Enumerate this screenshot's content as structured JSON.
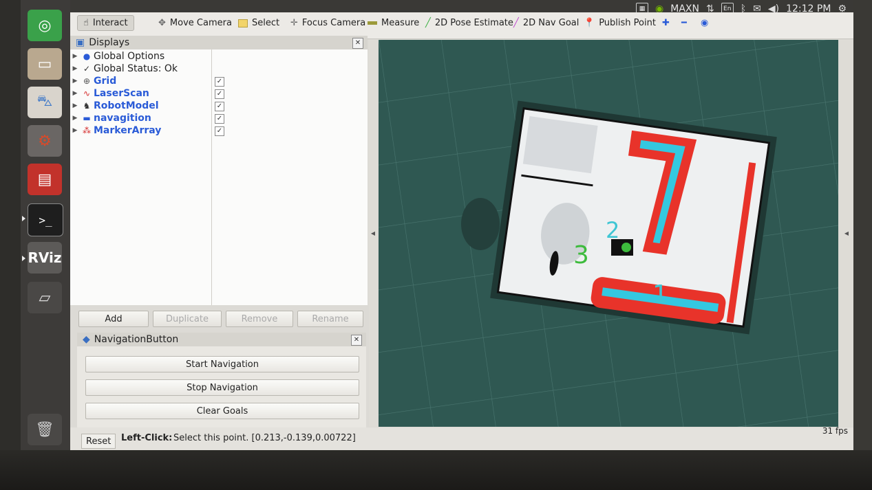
{
  "topbar": {
    "indicators": [
      "MAXN",
      "En"
    ],
    "time": "12:12 PM"
  },
  "launcher": {
    "rviz_label": "RViz"
  },
  "toolbar": {
    "tools": [
      {
        "label": "Interact",
        "icon": "hand-icon"
      },
      {
        "label": "Move Camera",
        "icon": "move-camera-icon"
      },
      {
        "label": "Select",
        "icon": "select-icon"
      },
      {
        "label": "Focus Camera",
        "icon": "focus-camera-icon"
      },
      {
        "label": "Measure",
        "icon": "measure-icon"
      },
      {
        "label": "2D Pose Estimate",
        "icon": "pose-estimate-icon"
      },
      {
        "label": "2D Nav Goal",
        "icon": "nav-goal-icon"
      },
      {
        "label": "Publish Point",
        "icon": "publish-point-icon"
      }
    ],
    "active_tool": "Interact"
  },
  "displays": {
    "title": "Displays",
    "items": [
      {
        "label": "Global Options",
        "checked": null,
        "blue": false
      },
      {
        "label": "Global Status: Ok",
        "checked": null,
        "blue": false
      },
      {
        "label": "Grid",
        "checked": true,
        "blue": true
      },
      {
        "label": "LaserScan",
        "checked": true,
        "blue": true
      },
      {
        "label": "RobotModel",
        "checked": true,
        "blue": true
      },
      {
        "label": "navagition",
        "checked": true,
        "blue": true
      },
      {
        "label": "MarkerArray",
        "checked": true,
        "blue": true
      }
    ],
    "buttons": {
      "add": "Add",
      "duplicate": "Duplicate",
      "remove": "Remove",
      "rename": "Rename"
    }
  },
  "navigation_panel": {
    "title": "NavigationButton",
    "start": "Start Navigation",
    "stop": "Stop Navigation",
    "clear": "Clear Goals"
  },
  "map": {
    "markers": [
      {
        "label": "1",
        "color": "#3fc6d4"
      },
      {
        "label": "2",
        "color": "#3fc6d4"
      },
      {
        "label": "3",
        "color": "#3dbb3d"
      }
    ]
  },
  "statusbar": {
    "reset": "Reset",
    "hint_key": "Left-Click:",
    "hint_text": "Select this point. [0.213,-0.139,0.00722]",
    "fps": "31 fps"
  },
  "colors": {
    "map_background": "#2f5852",
    "inflation": "#e8332a",
    "costmap_core": "#34c8e0",
    "accent_blue": "#2a5bd7"
  }
}
